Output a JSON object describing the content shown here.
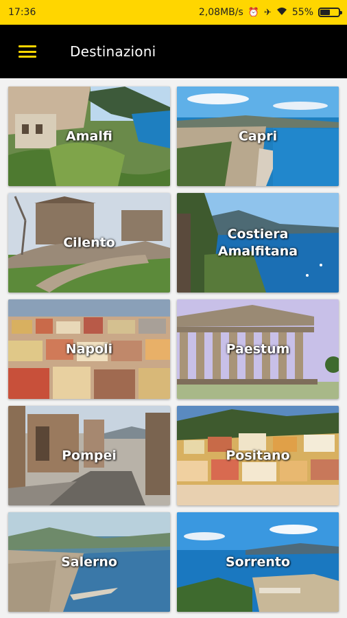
{
  "status_bar": {
    "time": "17:36",
    "speed": "2,08MB/s",
    "battery": "55%",
    "battery_level": 0.55,
    "icons": [
      "alarm-icon",
      "airplane-icon",
      "wifi-icon",
      "battery-icon"
    ]
  },
  "app_bar": {
    "menu_icon": "hamburger-menu-icon",
    "title": "Destinazioni",
    "accent": "#ffd600"
  },
  "destinations": [
    {
      "label": "Amalfi",
      "image": "amalfi-photo"
    },
    {
      "label": "Capri",
      "image": "capri-photo"
    },
    {
      "label": "Cilento",
      "image": "cilento-photo"
    },
    {
      "label": "Costiera\nAmalfitana",
      "image": "costiera-amalfitana-photo"
    },
    {
      "label": "Napoli",
      "image": "napoli-photo"
    },
    {
      "label": "Paestum",
      "image": "paestum-photo"
    },
    {
      "label": "Pompei",
      "image": "pompei-photo"
    },
    {
      "label": "Positano",
      "image": "positano-photo"
    },
    {
      "label": "Salerno",
      "image": "salerno-photo"
    },
    {
      "label": "Sorrento",
      "image": "sorrento-photo"
    }
  ]
}
